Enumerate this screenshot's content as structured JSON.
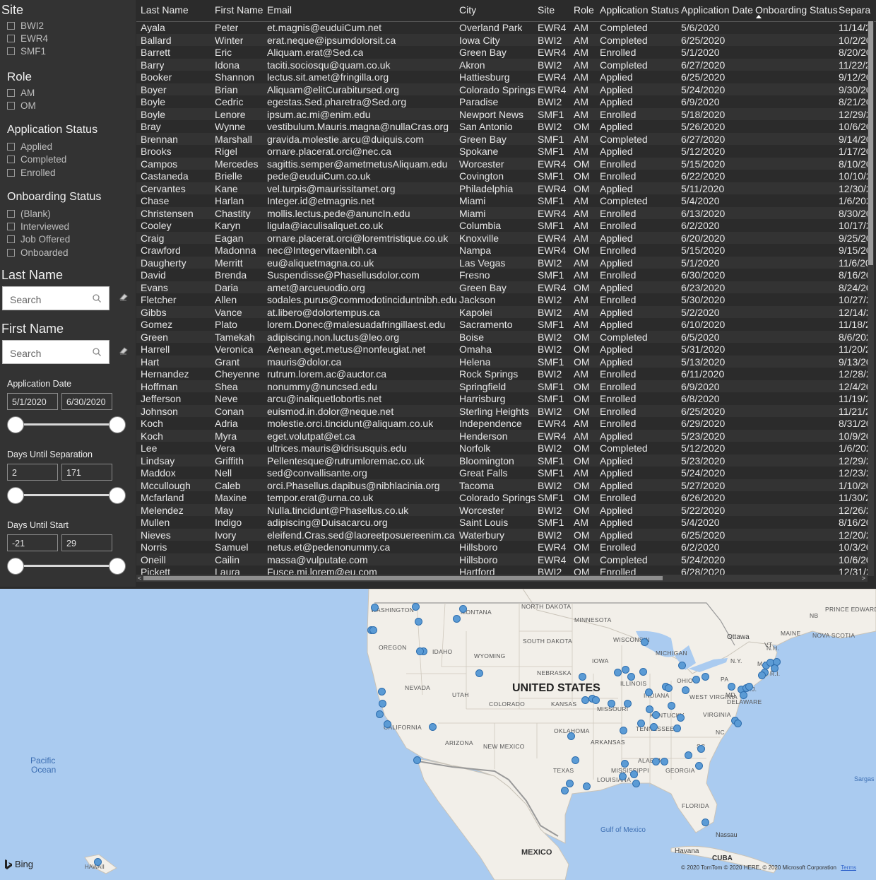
{
  "slicers": {
    "site": {
      "title": "Site",
      "options": [
        "BWI2",
        "EWR4",
        "SMF1"
      ]
    },
    "role": {
      "title": "Role",
      "options": [
        "AM",
        "OM"
      ]
    },
    "app_status": {
      "title": "Application Status",
      "options": [
        "Applied",
        "Completed",
        "Enrolled"
      ]
    },
    "onboarding": {
      "title": "Onboarding Status",
      "options": [
        "(Blank)",
        "Interviewed",
        "Job Offered",
        "Onboarded"
      ]
    },
    "last_name": {
      "title": "Last Name",
      "placeholder": "Search"
    },
    "first_name": {
      "title": "First Name",
      "placeholder": "Search"
    },
    "app_date": {
      "title": "Application Date",
      "min": "5/1/2020",
      "max": "6/30/2020"
    },
    "days_sep": {
      "title": "Days Until Separation",
      "min": "2",
      "max": "171"
    },
    "days_start": {
      "title": "Days Until Start",
      "min": "-21",
      "max": "29"
    }
  },
  "table": {
    "columns": [
      "Last Name",
      "First Name",
      "Email",
      "City",
      "Site",
      "Role",
      "Application Status",
      "Application Date",
      "Onboarding Status",
      "Separa"
    ],
    "rows": [
      [
        "Ayala",
        "Peter",
        "et.magnis@euduiCum.net",
        "Overland Park",
        "EWR4",
        "AM",
        "Completed",
        "5/6/2020",
        "",
        "11/14/2"
      ],
      [
        "Ballard",
        "Winter",
        "erat.neque@ipsumdolorsit.ca",
        "Iowa City",
        "BWI2",
        "AM",
        "Completed",
        "6/25/2020",
        "",
        "10/2/20"
      ],
      [
        "Barrett",
        "Eric",
        "Aliquam.erat@Sed.ca",
        "Green Bay",
        "EWR4",
        "AM",
        "Enrolled",
        "5/1/2020",
        "",
        "8/20/20"
      ],
      [
        "Barry",
        "Idona",
        "taciti.sociosqu@quam.co.uk",
        "Akron",
        "BWI2",
        "AM",
        "Completed",
        "6/27/2020",
        "",
        "11/22/2"
      ],
      [
        "Booker",
        "Shannon",
        "lectus.sit.amet@fringilla.org",
        "Hattiesburg",
        "EWR4",
        "AM",
        "Applied",
        "6/25/2020",
        "",
        "9/12/20"
      ],
      [
        "Boyer",
        "Brian",
        "Aliquam@elitCurabitursed.org",
        "Colorado Springs",
        "EWR4",
        "AM",
        "Applied",
        "5/24/2020",
        "",
        "9/30/20"
      ],
      [
        "Boyle",
        "Cedric",
        "egestas.Sed.pharetra@Sed.org",
        "Paradise",
        "BWI2",
        "AM",
        "Applied",
        "6/9/2020",
        "",
        "8/21/20"
      ],
      [
        "Boyle",
        "Lenore",
        "ipsum.ac.mi@enim.edu",
        "Newport News",
        "SMF1",
        "AM",
        "Enrolled",
        "5/18/2020",
        "",
        "12/29/2"
      ],
      [
        "Bray",
        "Wynne",
        "vestibulum.Mauris.magna@nullaCras.org",
        "San Antonio",
        "BWI2",
        "OM",
        "Applied",
        "5/26/2020",
        "",
        "10/6/20"
      ],
      [
        "Brennan",
        "Marshall",
        "gravida.molestie.arcu@duiquis.com",
        "Green Bay",
        "SMF1",
        "AM",
        "Completed",
        "6/27/2020",
        "",
        "9/14/20"
      ],
      [
        "Brooks",
        "Rigel",
        "ornare.placerat.orci@nec.ca",
        "Spokane",
        "SMF1",
        "AM",
        "Applied",
        "5/12/2020",
        "",
        "1/17/20"
      ],
      [
        "Campos",
        "Mercedes",
        "sagittis.semper@ametmetusAliquam.edu",
        "Worcester",
        "EWR4",
        "OM",
        "Enrolled",
        "5/15/2020",
        "",
        "8/10/20"
      ],
      [
        "Castaneda",
        "Brielle",
        "pede@euduiCum.co.uk",
        "Covington",
        "SMF1",
        "OM",
        "Enrolled",
        "6/22/2020",
        "",
        "10/10/2"
      ],
      [
        "Cervantes",
        "Kane",
        "vel.turpis@maurissitamet.org",
        "Philadelphia",
        "EWR4",
        "OM",
        "Applied",
        "5/11/2020",
        "",
        "12/30/2"
      ],
      [
        "Chase",
        "Harlan",
        "Integer.id@etmagnis.net",
        "Miami",
        "SMF1",
        "AM",
        "Completed",
        "5/4/2020",
        "",
        "1/6/202"
      ],
      [
        "Christensen",
        "Chastity",
        "mollis.lectus.pede@anuncIn.edu",
        "Miami",
        "EWR4",
        "AM",
        "Enrolled",
        "6/13/2020",
        "",
        "8/30/20"
      ],
      [
        "Cooley",
        "Karyn",
        "ligula@iaculisaliquet.co.uk",
        "Columbia",
        "SMF1",
        "AM",
        "Enrolled",
        "6/2/2020",
        "",
        "10/17/2"
      ],
      [
        "Craig",
        "Eagan",
        "ornare.placerat.orci@loremtristique.co.uk",
        "Knoxville",
        "EWR4",
        "AM",
        "Applied",
        "6/20/2020",
        "",
        "9/25/20"
      ],
      [
        "Crawford",
        "Madonna",
        "nec@Integervitaenibh.ca",
        "Nampa",
        "EWR4",
        "OM",
        "Enrolled",
        "5/15/2020",
        "",
        "9/15/20"
      ],
      [
        "Daugherty",
        "Merritt",
        "eu@aliquetmagna.co.uk",
        "Las Vegas",
        "BWI2",
        "AM",
        "Applied",
        "5/1/2020",
        "",
        "11/6/20"
      ],
      [
        "David",
        "Brenda",
        "Suspendisse@Phasellusdolor.com",
        "Fresno",
        "SMF1",
        "AM",
        "Enrolled",
        "6/30/2020",
        "",
        "8/16/20"
      ],
      [
        "Evans",
        "Daria",
        "amet@arcueuodio.org",
        "Green Bay",
        "EWR4",
        "OM",
        "Applied",
        "6/23/2020",
        "",
        "8/24/20"
      ],
      [
        "Fletcher",
        "Allen",
        "sodales.purus@commodotinciduntnibh.edu",
        "Jackson",
        "BWI2",
        "AM",
        "Enrolled",
        "5/30/2020",
        "",
        "10/27/2"
      ],
      [
        "Gibbs",
        "Vance",
        "at.libero@dolortempus.ca",
        "Kapolei",
        "BWI2",
        "AM",
        "Applied",
        "5/2/2020",
        "",
        "12/14/2"
      ],
      [
        "Gomez",
        "Plato",
        "lorem.Donec@malesuadafringillaest.edu",
        "Sacramento",
        "SMF1",
        "AM",
        "Applied",
        "6/10/2020",
        "",
        "11/18/2"
      ],
      [
        "Green",
        "Tamekah",
        "adipiscing.non.luctus@leo.org",
        "Boise",
        "BWI2",
        "OM",
        "Completed",
        "6/5/2020",
        "",
        "8/6/202"
      ],
      [
        "Harrell",
        "Veronica",
        "Aenean.eget.metus@nonfeugiat.net",
        "Omaha",
        "BWI2",
        "OM",
        "Applied",
        "5/31/2020",
        "",
        "11/20/2"
      ],
      [
        "Hart",
        "Grant",
        "mauris@dolor.ca",
        "Helena",
        "SMF1",
        "OM",
        "Applied",
        "5/13/2020",
        "",
        "9/13/20"
      ],
      [
        "Hernandez",
        "Cheyenne",
        "rutrum.lorem.ac@auctor.ca",
        "Rock Springs",
        "BWI2",
        "AM",
        "Enrolled",
        "6/11/2020",
        "",
        "12/28/2"
      ],
      [
        "Hoffman",
        "Shea",
        "nonummy@nuncsed.edu",
        "Springfield",
        "SMF1",
        "OM",
        "Enrolled",
        "6/9/2020",
        "",
        "12/4/20"
      ],
      [
        "Jefferson",
        "Neve",
        "arcu@inaliquetlobortis.net",
        "Harrisburg",
        "SMF1",
        "OM",
        "Enrolled",
        "6/8/2020",
        "",
        "11/19/2"
      ],
      [
        "Johnson",
        "Conan",
        "euismod.in.dolor@neque.net",
        "Sterling Heights",
        "BWI2",
        "OM",
        "Enrolled",
        "6/25/2020",
        "",
        "11/21/2"
      ],
      [
        "Koch",
        "Adria",
        "molestie.orci.tincidunt@aliquam.co.uk",
        "Independence",
        "EWR4",
        "AM",
        "Enrolled",
        "6/29/2020",
        "",
        "8/31/20"
      ],
      [
        "Koch",
        "Myra",
        "eget.volutpat@et.ca",
        "Henderson",
        "EWR4",
        "AM",
        "Applied",
        "5/23/2020",
        "",
        "10/9/20"
      ],
      [
        "Lee",
        "Vera",
        "ultrices.mauris@idrisusquis.edu",
        "Norfolk",
        "BWI2",
        "OM",
        "Completed",
        "5/12/2020",
        "",
        "1/6/202"
      ],
      [
        "Lindsay",
        "Griffith",
        "Pellentesque@rutrumloremac.co.uk",
        "Bloomington",
        "SMF1",
        "OM",
        "Applied",
        "5/23/2020",
        "",
        "12/29/2"
      ],
      [
        "Maddox",
        "Nell",
        "sed@convallisante.org",
        "Great Falls",
        "SMF1",
        "AM",
        "Applied",
        "5/24/2020",
        "",
        "12/23/2"
      ],
      [
        "Mccullough",
        "Caleb",
        "orci.Phasellus.dapibus@nibhlacinia.org",
        "Tacoma",
        "BWI2",
        "OM",
        "Applied",
        "5/27/2020",
        "",
        "1/10/20"
      ],
      [
        "Mcfarland",
        "Maxine",
        "tempor.erat@urna.co.uk",
        "Colorado Springs",
        "SMF1",
        "OM",
        "Enrolled",
        "6/26/2020",
        "",
        "11/30/2"
      ],
      [
        "Melendez",
        "May",
        "Nulla.tincidunt@Phasellus.co.uk",
        "Worcester",
        "BWI2",
        "OM",
        "Applied",
        "5/22/2020",
        "",
        "12/26/2"
      ],
      [
        "Mullen",
        "Indigo",
        "adipiscing@Duisacarcu.org",
        "Saint Louis",
        "SMF1",
        "AM",
        "Applied",
        "5/4/2020",
        "",
        "8/16/20"
      ],
      [
        "Nieves",
        "Ivory",
        "eleifend.Cras.sed@laoreetposuereenim.ca",
        "Waterbury",
        "BWI2",
        "OM",
        "Applied",
        "6/25/2020",
        "",
        "12/20/2"
      ],
      [
        "Norris",
        "Samuel",
        "netus.et@pedenonummy.ca",
        "Hillsboro",
        "EWR4",
        "OM",
        "Enrolled",
        "6/2/2020",
        "",
        "10/3/20"
      ],
      [
        "Oneill",
        "Cailin",
        "massa@vulputate.com",
        "Hillsboro",
        "EWR4",
        "OM",
        "Completed",
        "5/24/2020",
        "",
        "10/6/20"
      ],
      [
        "Pickett",
        "Laura",
        "Fusce.mi.lorem@eu.com",
        "Hartford",
        "BWI2",
        "OM",
        "Enrolled",
        "6/28/2020",
        "",
        "12/31/2"
      ]
    ]
  },
  "map": {
    "country_label": "UNITED STATES",
    "ocean_label": [
      "Pacific",
      "Ocean"
    ],
    "gulf_label": "Gulf of Mexico",
    "mexico_label": "MEXICO",
    "cuba_label": "CUBA",
    "havana_label": "Havana",
    "nassau_label": "Nassau",
    "ottawa_label": "Ottawa",
    "sargasso_label": "Sargas",
    "hawaii_label": "HAWAII",
    "states": [
      "WASHINGTON",
      "MONTANA",
      "NORTH DAKOTA",
      "MINNESOTA",
      "OREGON",
      "IDAHO",
      "SOUTH DAKOTA",
      "WYOMING",
      "WISCONSIN",
      "MICHIGAN",
      "IOWA",
      "NEBRASKA",
      "NEVADA",
      "UTAH",
      "COLORADO",
      "KANSAS",
      "ILLINOIS",
      "INDIANA",
      "OHIO",
      "PA",
      "MISSOURI",
      "KENTUCKY",
      "WEST VIRGINIA",
      "VIRGINIA",
      "CALIFORNIA",
      "OKLAHOMA",
      "TENNESSEE",
      "NC",
      "SC",
      "ARKANSAS",
      "ARIZONA",
      "NEW MEXICO",
      "TEXAS",
      "MISSISSIPPI",
      "ALABAMA",
      "GEORGIA",
      "LOUISIANA",
      "FLORIDA",
      "MAINE",
      "VT",
      "N.H.",
      "N.Y.",
      "MASS.",
      "R.I.",
      "N.J.",
      "MD.",
      "DELAWARE",
      "NB",
      "NOVA SCOTIA",
      "PRINCE EDWARD ISLAND"
    ],
    "bing_label": "Bing",
    "copyright": "© 2020 TomTom © 2020 HERE, © 2020 Microsoft Corporation",
    "terms_label": "Terms"
  }
}
